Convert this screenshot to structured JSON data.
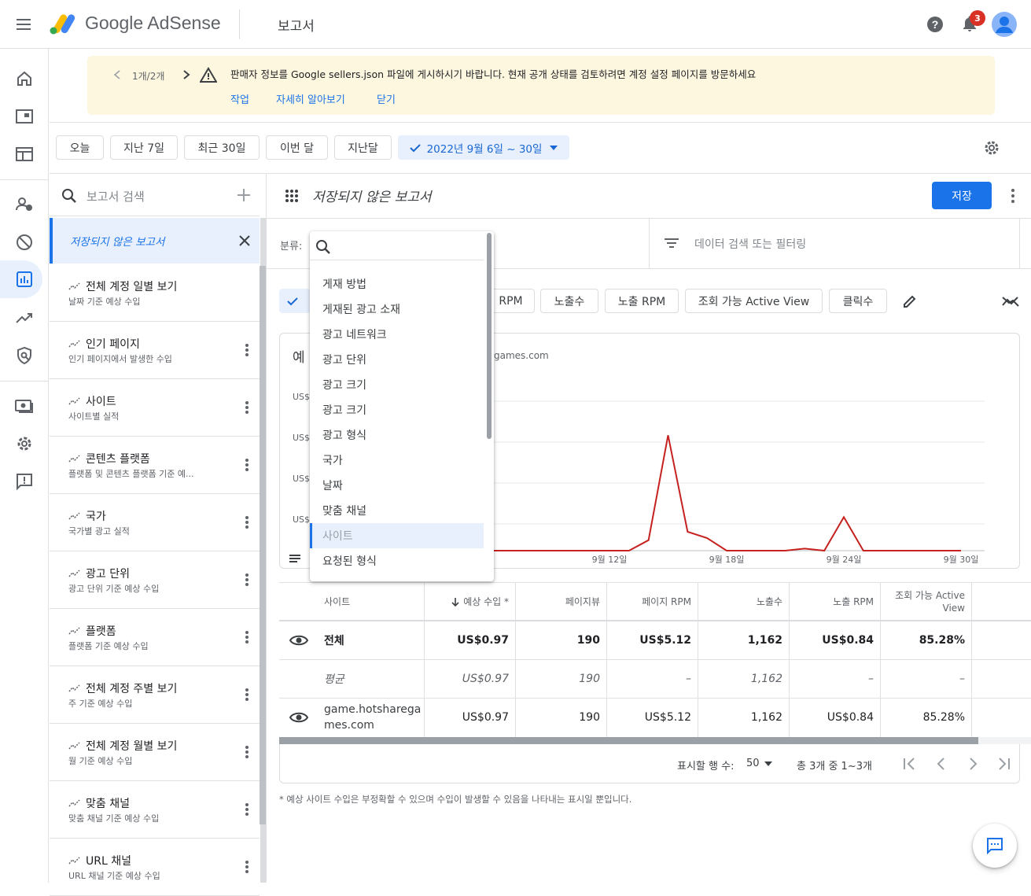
{
  "app": {
    "brand": "Google AdSense",
    "page_title": "보고서",
    "notification_count": "3"
  },
  "banner": {
    "pager": "1개/2개",
    "message": "판매자 정보를 Google sellers.json 파일에 게시하시기 바랍니다. 현재 공개 상태를 검토하려면 계정 설정 페이지를 방문하세요",
    "actions": [
      "작업",
      "자세히 알아보기",
      "닫기"
    ]
  },
  "date_chips": [
    "오늘",
    "지난 7일",
    "최근 30일",
    "이번 달",
    "지난달"
  ],
  "date_range": "2022년 9월 6일 ~ 30일",
  "reports": {
    "search_placeholder": "보고서 검색",
    "unsaved": "저장되지 않은 보고서",
    "items": [
      {
        "title": "전체 계정 일별 보기",
        "subtitle": "날짜 기준 예상 수입"
      },
      {
        "title": "인기 페이지",
        "subtitle": "인기 페이지에서 발생한 수입"
      },
      {
        "title": "사이트",
        "subtitle": "사이트별 실적"
      },
      {
        "title": "콘텐츠 플랫폼",
        "subtitle": "플랫폼 및 콘텐츠 플랫폼 기준 예..."
      },
      {
        "title": "국가",
        "subtitle": "국가별 광고 실적"
      },
      {
        "title": "광고 단위",
        "subtitle": "광고 단위 기준 예상 수입"
      },
      {
        "title": "플랫폼",
        "subtitle": "플랫폼 기준 예상 수입"
      },
      {
        "title": "전체 계정 주별 보기",
        "subtitle": "주 기준 예상 수입"
      },
      {
        "title": "전체 계정 월별 보기",
        "subtitle": "월 기준 예상 수입"
      },
      {
        "title": "맞춤 채널",
        "subtitle": "맞춤 채널 기준 예상 수입"
      },
      {
        "title": "URL 채널",
        "subtitle": "URL 채널 기준 예상 수입"
      }
    ]
  },
  "report": {
    "title": "저장되지 않은 보고서",
    "save_label": "저장",
    "breakdown_label": "분류:",
    "filter_placeholder": "데이터 검색 또는 필터링",
    "metric_chips": [
      "RPM",
      "노출수",
      "노출 RPM",
      "조회 가능 Active View",
      "클릭수"
    ],
    "chart_title_partial": "예",
    "chart_subtitle_partial": "games.com",
    "y_tick_prefix": "US$"
  },
  "dropdown": {
    "items": [
      "게재 방법",
      "게재된 광고 소재",
      "광고 네트워크",
      "광고 단위",
      "광고 크기",
      "광고 크기",
      "광고 형식",
      "국가",
      "날짜",
      "맞춤 채널",
      "사이트",
      "요청된 형식"
    ],
    "selected": "사이트"
  },
  "chart_data": {
    "type": "line",
    "x": [
      "9월 6일",
      "9월 7일",
      "9월 8일",
      "9월 9일",
      "9월 10일",
      "9월 11일",
      "9월 12일",
      "9월 13일",
      "9월 14일",
      "9월 15일",
      "9월 16일",
      "9월 17일",
      "9월 18일",
      "9월 19일",
      "9월 20일",
      "9월 21일",
      "9월 22일",
      "9월 23일",
      "9월 24일",
      "9월 25일",
      "9월 26일",
      "9월 27일",
      "9월 28일",
      "9월 29일",
      "9월 30일"
    ],
    "x_ticks": [
      "9월 12일",
      "9월 18일",
      "9월 24일",
      "9월 30일"
    ],
    "values": [
      0,
      0,
      0,
      0,
      0,
      0,
      0,
      0,
      0.05,
      0.55,
      0.09,
      0.06,
      0,
      0,
      0,
      0,
      0.01,
      0,
      0.16,
      0,
      0,
      0,
      0,
      0,
      0
    ],
    "ylim": [
      0,
      0.6
    ],
    "series_color": "#c5221f",
    "grid": true
  },
  "table": {
    "columns": [
      "사이트",
      "예상 수입 *",
      "페이지뷰",
      "페이지 RPM",
      "노출수",
      "노출 RPM",
      "조회 가능 Active View"
    ],
    "total": {
      "label": "전체",
      "values": [
        "US$0.97",
        "190",
        "US$5.12",
        "1,162",
        "US$0.84",
        "85.28%"
      ]
    },
    "average": {
      "label": "평균",
      "values": [
        "US$0.97",
        "190",
        "–",
        "1,162",
        "–",
        "–"
      ]
    },
    "rows": [
      {
        "site": "game.hotsharegames.com",
        "site_line1": "game.hotsharega",
        "site_line2": "mes.com",
        "values": [
          "US$0.97",
          "190",
          "US$5.12",
          "1,162",
          "US$0.84",
          "85.28%"
        ]
      }
    ],
    "rows_per_page_label": "표시할 행 수:",
    "rows_per_page": "50",
    "range_text": "총 3개 중 1~3개"
  },
  "footnote": "* 예상 사이트 수입은 부정확할 수 있으며 수입이 발생할 수 있음을 나타내는 표시일 뿐입니다.",
  "colors": {
    "accent": "#1a73e8",
    "banner_bg": "#fef7e0",
    "chart_line": "#c5221f",
    "badge": "#d93025"
  }
}
